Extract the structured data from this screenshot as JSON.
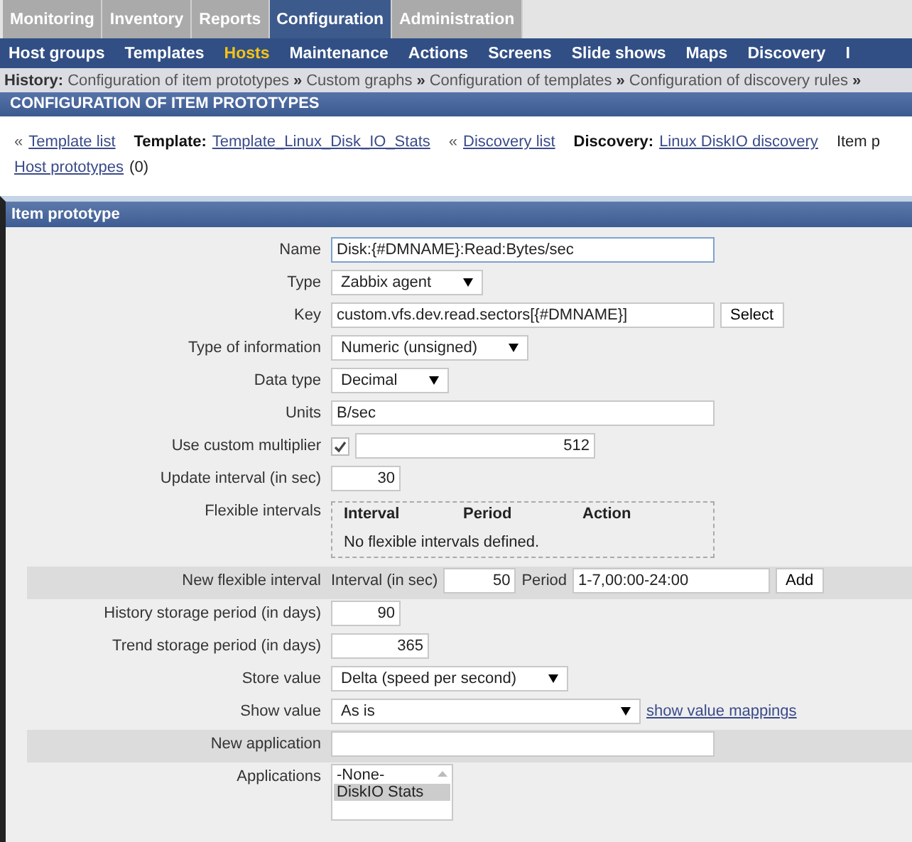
{
  "main_menu": [
    {
      "label": "Monitoring",
      "selected": false
    },
    {
      "label": "Inventory",
      "selected": false
    },
    {
      "label": "Reports",
      "selected": false
    },
    {
      "label": "Configuration",
      "selected": true
    },
    {
      "label": "Administration",
      "selected": false
    }
  ],
  "sub_menu": [
    {
      "label": "Host groups",
      "selected": false
    },
    {
      "label": "Templates",
      "selected": false
    },
    {
      "label": "Hosts",
      "selected": true
    },
    {
      "label": "Maintenance",
      "selected": false
    },
    {
      "label": "Actions",
      "selected": false
    },
    {
      "label": "Screens",
      "selected": false
    },
    {
      "label": "Slide shows",
      "selected": false
    },
    {
      "label": "Maps",
      "selected": false
    },
    {
      "label": "Discovery",
      "selected": false
    },
    {
      "label": "I",
      "selected": false
    }
  ],
  "history": {
    "label": "History:",
    "separator": "»",
    "items": [
      "Configuration of item prototypes",
      "Custom graphs",
      "Configuration of templates",
      "Configuration of discovery rules"
    ],
    "trailing": "»"
  },
  "page_title": "CONFIGURATION OF ITEM PROTOTYPES",
  "breadcrumbs": [
    {
      "prefix": "«",
      "link": "Template list"
    },
    {
      "label": "Template:",
      "link": "Template_Linux_Disk_IO_Stats"
    },
    {
      "prefix": "«",
      "link": "Discovery list"
    },
    {
      "label": "Discovery:",
      "link": "Linux DiskIO discovery"
    },
    {
      "text": "Item p"
    },
    {
      "link": "Host prototypes",
      "count": "(0)"
    }
  ],
  "form": {
    "title": "Item prototype",
    "rows": [
      {
        "kind": "text",
        "label": "Name",
        "value": "Disk:{#DMNAME}:Read:Bytes/sec",
        "focused": true
      },
      {
        "kind": "select",
        "label": "Type",
        "value": "Zabbix agent"
      },
      {
        "kind": "text_button",
        "label": "Key",
        "value": "custom.vfs.dev.read.sectors[{#DMNAME}]",
        "button": "Select"
      },
      {
        "kind": "select",
        "label": "Type of information",
        "value": "Numeric (unsigned)"
      },
      {
        "kind": "select",
        "label": "Data type",
        "value": "Decimal"
      },
      {
        "kind": "text",
        "label": "Units",
        "value": "B/sec",
        "focused": false
      },
      {
        "kind": "multiplier",
        "label": "Use custom multiplier",
        "checked": true,
        "value": "512"
      },
      {
        "kind": "number",
        "label": "Update interval (in sec)",
        "value": "30"
      },
      {
        "kind": "flex_table",
        "label": "Flexible intervals",
        "columns": [
          "Interval",
          "Period",
          "Action"
        ],
        "empty": "No flexible intervals defined."
      },
      {
        "kind": "flex_new",
        "label": "New flexible interval",
        "interval_label": "Interval (in sec)",
        "interval": "50",
        "period_label": "Period",
        "period": "1-7,00:00-24:00",
        "button": "Add"
      },
      {
        "kind": "number",
        "label": "History storage period (in days)",
        "value": "90"
      },
      {
        "kind": "number",
        "label": "Trend storage period (in days)",
        "value": "365"
      },
      {
        "kind": "select",
        "label": "Store value",
        "value": "Delta (speed per second)"
      },
      {
        "kind": "select_link",
        "label": "Show value",
        "value": "As is",
        "link": "show value mappings"
      },
      {
        "kind": "empty_text",
        "label": "New application"
      },
      {
        "kind": "listbox",
        "label": "Applications",
        "options": [
          {
            "label": "-None-",
            "selected": false
          },
          {
            "label": "DiskIO Stats",
            "selected": true
          }
        ]
      }
    ]
  }
}
